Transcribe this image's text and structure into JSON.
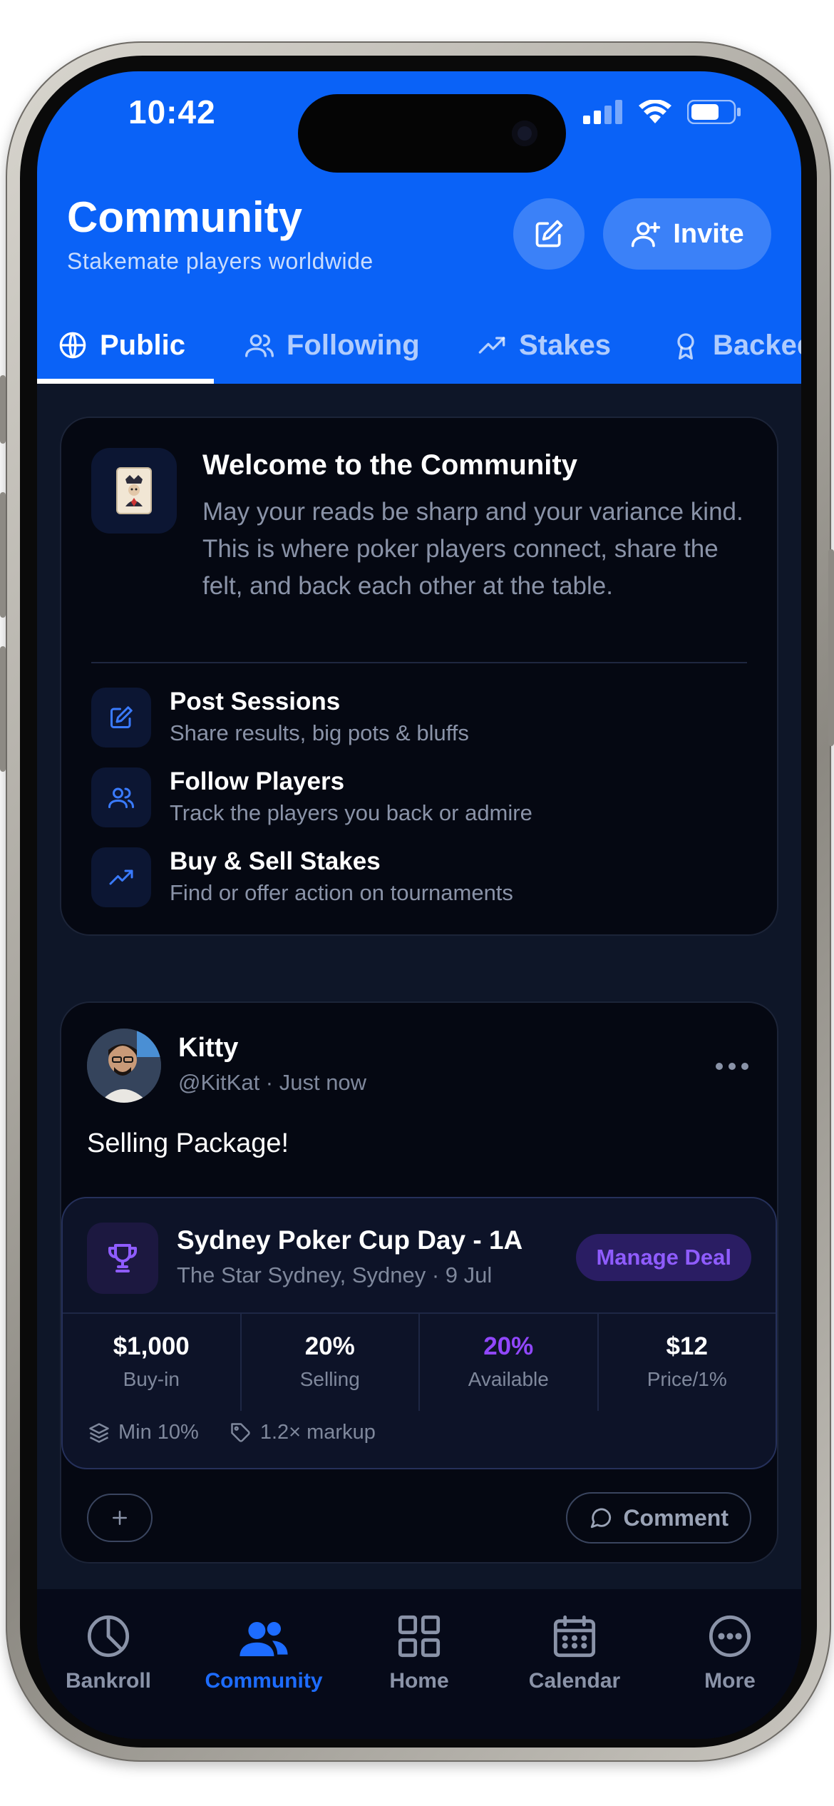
{
  "status_bar": {
    "time": "10:42"
  },
  "header": {
    "title": "Community",
    "subtitle": "Stakemate players worldwide",
    "invite_label": "Invite",
    "tabs": [
      {
        "label": "Public",
        "icon": "globe-icon",
        "active": true
      },
      {
        "label": "Following",
        "icon": "users-icon",
        "active": false
      },
      {
        "label": "Stakes",
        "icon": "trending-up-icon",
        "active": false
      },
      {
        "label": "Backed",
        "icon": "award-icon",
        "active": false
      }
    ]
  },
  "welcome": {
    "title": "Welcome to the Community",
    "body": "May your reads be sharp and your variance kind. This is where poker players connect, share the felt, and back each other at the table.",
    "features": [
      {
        "title": "Post Sessions",
        "desc": "Share results, big pots & bluffs",
        "icon": "edit-icon"
      },
      {
        "title": "Follow Players",
        "desc": "Track the players you back or admire",
        "icon": "users-icon"
      },
      {
        "title": "Buy & Sell Stakes",
        "desc": "Find or offer action on tournaments",
        "icon": "trending-up-icon"
      }
    ]
  },
  "post": {
    "author_name": "Kitty",
    "author_meta": "@KitKat · Just now",
    "text": "Selling Package!",
    "deal": {
      "title": "Sydney Poker Cup Day - 1A",
      "subtitle": "The Star Sydney, Sydney · 9 Jul",
      "manage_label": "Manage Deal",
      "stats": [
        {
          "value": "$1,000",
          "label": "Buy-in"
        },
        {
          "value": "20%",
          "label": "Selling"
        },
        {
          "value": "20%",
          "label": "Available"
        },
        {
          "value": "$12",
          "label": "Price/1%"
        }
      ],
      "min": "Min 10%",
      "markup": "1.2× markup"
    },
    "comment_label": "Comment"
  },
  "tabbar": {
    "items": [
      {
        "label": "Bankroll",
        "icon": "pie-chart-icon",
        "active": false
      },
      {
        "label": "Community",
        "icon": "users-icon",
        "active": true
      },
      {
        "label": "Home",
        "icon": "grid-icon",
        "active": false
      },
      {
        "label": "Calendar",
        "icon": "calendar-icon",
        "active": false
      },
      {
        "label": "More",
        "icon": "more-icon",
        "active": false
      }
    ]
  },
  "colors": {
    "header_blue": "#0a62f7",
    "background": "#0e1628",
    "card": "#050812",
    "accent_purple": "#9147ff",
    "tab_active": "#1d6cff"
  }
}
